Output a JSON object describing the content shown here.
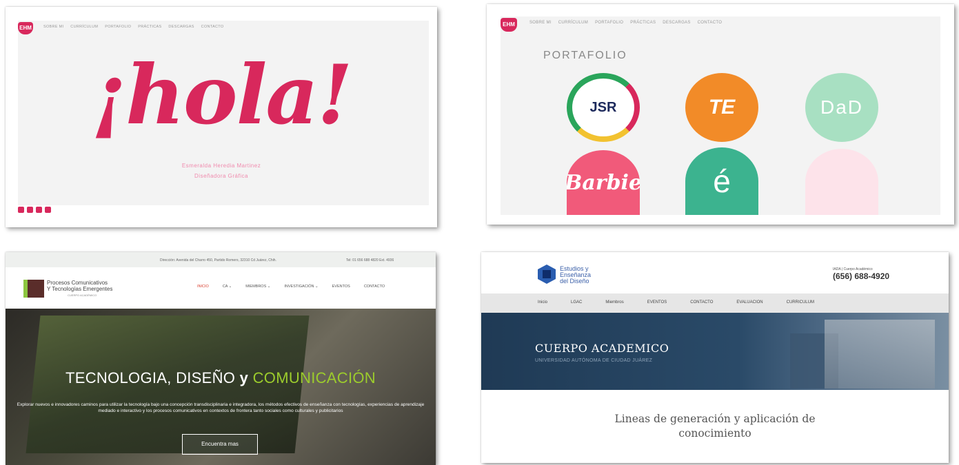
{
  "colors": {
    "pink": "#d8285c",
    "pink_light": "#f08aad",
    "green": "#9ccc2c",
    "navy": "#1f3a55",
    "blue": "#3a5fa8"
  },
  "panel1": {
    "logo": "EHM",
    "nav": [
      "SOBRE MI",
      "CURRÍCULUM",
      "PORTAFOLIO",
      "PRÁCTICAS",
      "DESCARGAS",
      "CONTACTO"
    ],
    "headline": "¡hola!",
    "name": "Esmeralda Heredia Martinez",
    "role": "Diseñadora Gráfica",
    "social_icons": [
      "facebook-icon",
      "linkedin-icon",
      "instagram-icon",
      "email-icon"
    ]
  },
  "panel2": {
    "logo": "EHM",
    "nav": [
      "SOBRE MI",
      "CURRÍCULUM",
      "PORTAFOLIO",
      "PRÁCTICAS",
      "DESCARGAS",
      "CONTACTO"
    ],
    "title": "PORTAFOLIO",
    "items": [
      {
        "label": "JSR"
      },
      {
        "label": "TE"
      },
      {
        "label": "DaD"
      },
      {
        "label": "Barbie"
      },
      {
        "label": "é"
      },
      {
        "label": ""
      }
    ]
  },
  "panel3": {
    "address": "Dirección: Avenida del Charro 450, Partido Romero, 32310 Cd Juárez, Chih.",
    "tel": "Tel: 01 656 688 4820 Ext. 4936",
    "brand_line1": "Procesos Comunicativos",
    "brand_line2": "Y Tecnologías Emergentes",
    "brand_small": "CUERPO ACADÉMICO",
    "menu": [
      "INICIO",
      "CA ⌄",
      "MIEMBROS ⌄",
      "INVESTIGACIÓN ⌄",
      "EVENTOS",
      "CONTACTO"
    ],
    "headline_a": "TECNOLOGIA, DISEÑO ",
    "headline_b": "y",
    "headline_c": " COMUNICACIÓN",
    "paragraph": "Explorar nuevos e innovadores caminos para utilizar la tecnología bajo una concepción transdisciplinaria e integradora, los métodos efectivos de enseñanza con tecnologías, experiencias de aprendizaje mediado e interactivo y los procesos comunicativos en contextos de frontera tanto sociales como culturales y publicitarios",
    "button": "Encuentra mas"
  },
  "panel4": {
    "brand_line1": "Estudios y",
    "brand_line2": "Enseñanza",
    "brand_line3": "del Diseño",
    "contact_label": "IADA | Cuerpo Académico",
    "phone": "(656) 688-4920",
    "nav": [
      "Inicio",
      "LGAC",
      "Miembros",
      "EVENTOS",
      "CONTACTO",
      "EVALUACION",
      "CURRICULUM"
    ],
    "banner_title": "CUERPO ACADEMICO",
    "banner_sub": "UNIVERSIDAD AUTÓNOMA DE CIUDAD JUÁREZ",
    "lines_1": "Lineas de generación y aplicación de",
    "lines_2": "conocimiento"
  }
}
